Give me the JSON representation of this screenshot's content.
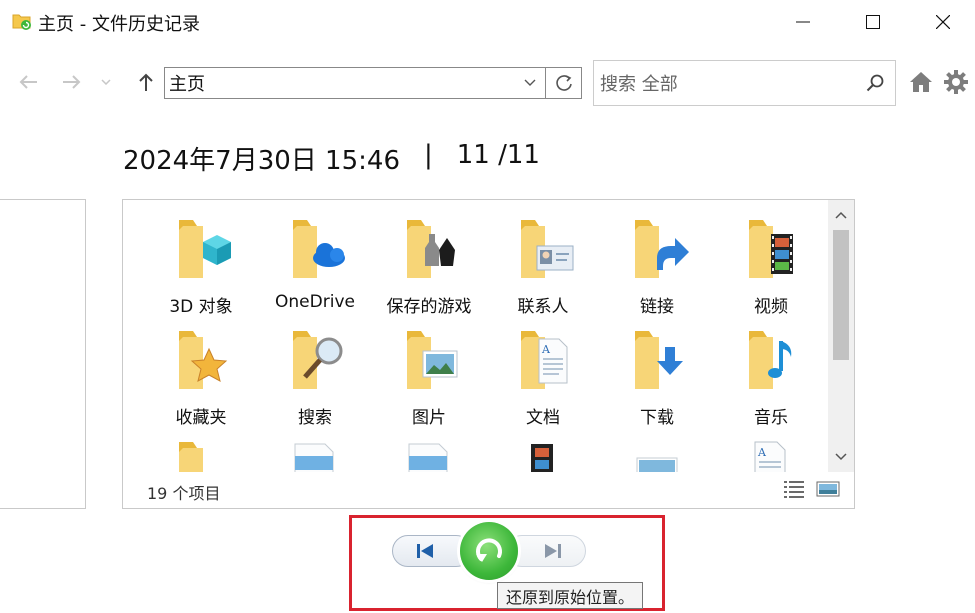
{
  "window": {
    "title": "主页 - 文件历史记录"
  },
  "toolbar": {
    "address_value": "主页",
    "search_placeholder": "搜索 全部"
  },
  "snapshot": {
    "datetime": "2024年7月30日 15:46",
    "separator": "|",
    "position": "11 /11"
  },
  "items": [
    {
      "label": "3D 对象",
      "icon": "3d-objects-folder-icon"
    },
    {
      "label": "OneDrive",
      "icon": "onedrive-folder-icon"
    },
    {
      "label": "保存的游戏",
      "icon": "saved-games-folder-icon"
    },
    {
      "label": "联系人",
      "icon": "contacts-folder-icon"
    },
    {
      "label": "链接",
      "icon": "links-folder-icon"
    },
    {
      "label": "视频",
      "icon": "videos-folder-icon"
    },
    {
      "label": "收藏夹",
      "icon": "favorites-folder-icon"
    },
    {
      "label": "搜索",
      "icon": "searches-folder-icon"
    },
    {
      "label": "图片",
      "icon": "pictures-folder-icon"
    },
    {
      "label": "文档",
      "icon": "documents-folder-icon"
    },
    {
      "label": "下载",
      "icon": "downloads-folder-icon"
    },
    {
      "label": "音乐",
      "icon": "music-folder-icon"
    },
    {
      "label": "",
      "icon": "folder-icon"
    },
    {
      "label": "",
      "icon": "file-icon"
    },
    {
      "label": "",
      "icon": "file-icon"
    },
    {
      "label": "",
      "icon": "video-file-icon"
    },
    {
      "label": "",
      "icon": "image-file-icon"
    },
    {
      "label": "",
      "icon": "document-file-icon"
    }
  ],
  "status": {
    "count": "19 个项目"
  },
  "playback": {
    "tooltip": "还原到原始位置。"
  },
  "colors": {
    "folder": "#f5c84c",
    "restore_green": "#3db73a",
    "highlight_red": "#d9232f"
  }
}
